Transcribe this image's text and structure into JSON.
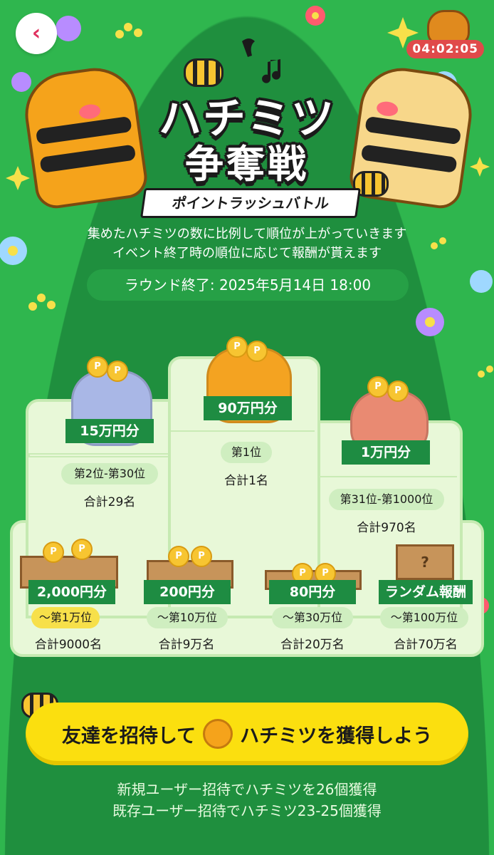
{
  "header": {
    "timer": "04:02:05"
  },
  "title": {
    "line1": "ハチミツ",
    "line2": "争奪戦",
    "subtitle": "ポイントラッシュバトル"
  },
  "description": [
    "集めたハチミツの数に比例して順位が上がっていきます",
    "イベント終了時の順位に応じて報酬が貰えます"
  ],
  "round_end": "ラウンド終了: 2025年5月14日 18:00",
  "podium": {
    "first": {
      "prize": "90万円分",
      "rank": "第1位",
      "total": "合計1名"
    },
    "second": {
      "prize": "15万円分",
      "rank": "第2位-第30位",
      "total": "合計29名"
    },
    "third": {
      "prize": "1万円分",
      "rank": "第31位-第1000位",
      "total": "合計970名"
    }
  },
  "tiers": [
    {
      "prize": "2,000円分",
      "rank": "〜第1万位",
      "total": "合計9000名"
    },
    {
      "prize": "200円分",
      "rank": "〜第10万位",
      "total": "合計9万名"
    },
    {
      "prize": "80円分",
      "rank": "〜第30万位",
      "total": "合計20万名"
    },
    {
      "prize": "ランダム報酬",
      "rank": "〜第100万位",
      "total": "合計70万名"
    }
  ],
  "cta": {
    "label_before": "友達を招待して",
    "label_after": "ハチミツを獲得しよう",
    "icon": "honey-dipper-icon"
  },
  "footer": [
    "新規ユーザー招待でハチミツを26個獲得",
    "既存ユーザー招待でハチミツ23-25個獲得"
  ],
  "colors": {
    "background": "#2fb64e",
    "ribbon": "#1e8c42",
    "cta": "#fbdf0f",
    "timer": "#e04a4a"
  }
}
